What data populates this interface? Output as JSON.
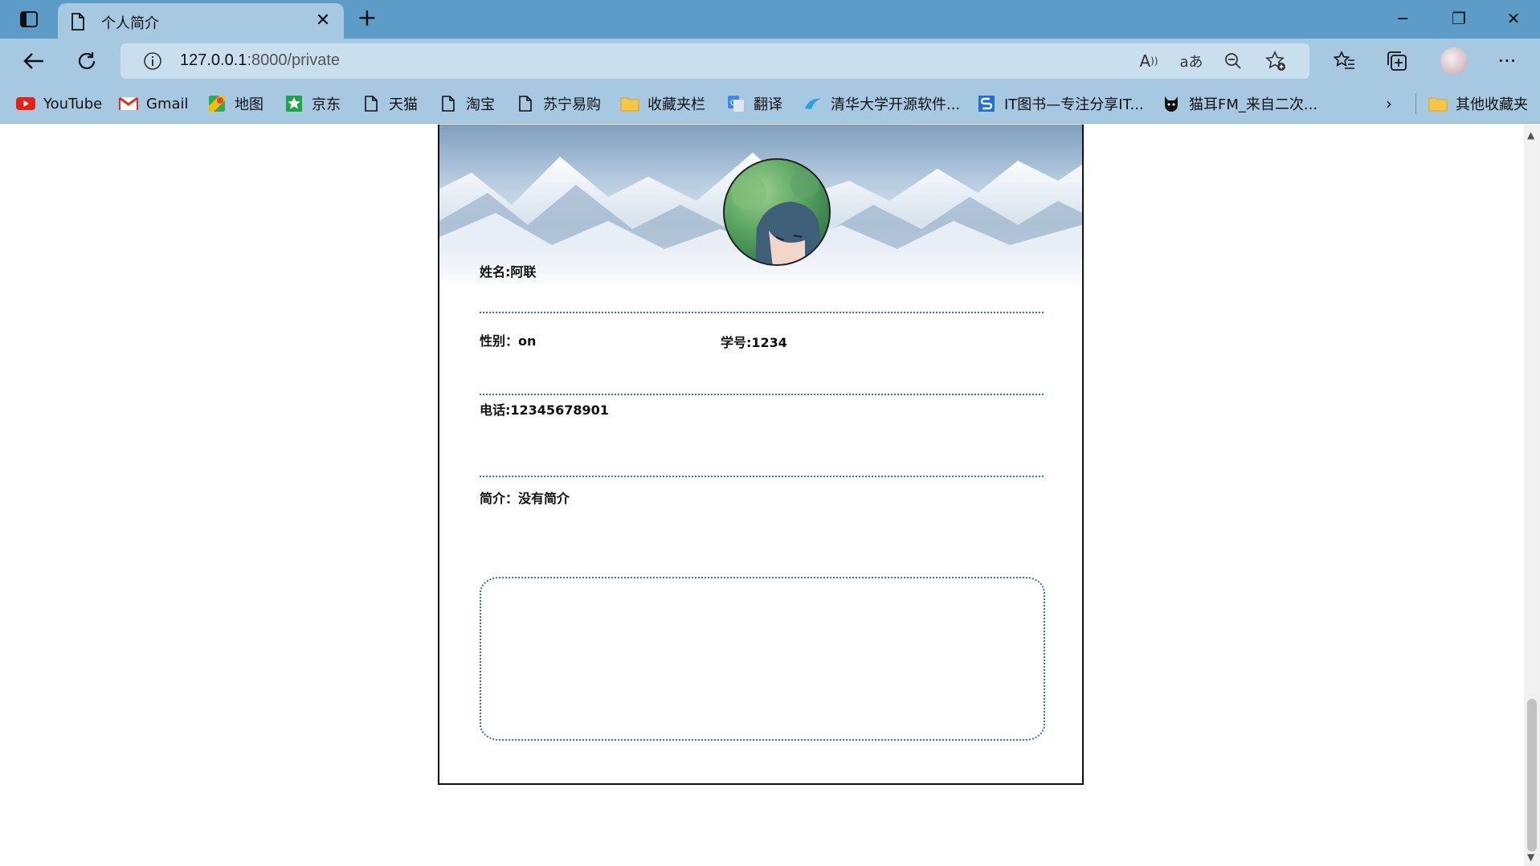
{
  "browser": {
    "tab_title": "个人简介",
    "url_host": "127.0.0.1",
    "url_path": ":8000/private",
    "bookmarks": [
      {
        "label": "YouTube",
        "icon": "youtube-icon"
      },
      {
        "label": "Gmail",
        "icon": "gmail-icon"
      },
      {
        "label": "地图",
        "icon": "maps-icon"
      },
      {
        "label": "京东",
        "icon": "jd-icon"
      },
      {
        "label": "天猫",
        "icon": "page-icon"
      },
      {
        "label": "淘宝",
        "icon": "page-icon"
      },
      {
        "label": "苏宁易购",
        "icon": "page-icon"
      },
      {
        "label": "收藏夹栏",
        "icon": "folder-icon"
      },
      {
        "label": "翻译",
        "icon": "translate-icon"
      },
      {
        "label": "清华大学开源软件...",
        "icon": "tsinghua-icon"
      },
      {
        "label": "IT图书—专注分享IT...",
        "icon": "itbook-icon"
      },
      {
        "label": "猫耳FM_来自二次...",
        "icon": "missevan-icon"
      }
    ],
    "other_bookmarks": "其他收藏夹",
    "colors": {
      "tabbar": "#5d9cc6",
      "toolbar": "#a6c9e1",
      "address": "#c9dfee"
    }
  },
  "profile": {
    "name": "姓名:阿联",
    "gender": "性别：on",
    "student_id": "学号:1234",
    "phone": "电话:12345678901",
    "intro": "简介：没有简介",
    "divider_color": "#2a6fd6"
  }
}
